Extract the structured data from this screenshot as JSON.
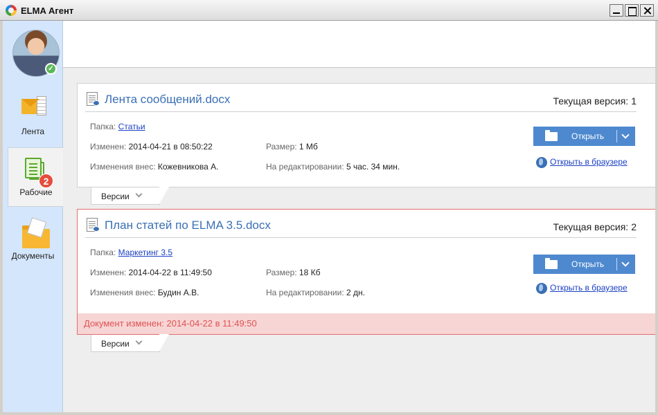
{
  "window": {
    "title": "ELMA Агент"
  },
  "sidebar": {
    "items": [
      {
        "label": "Лента"
      },
      {
        "label": "Рабочие",
        "badge": "2"
      },
      {
        "label": "Документы"
      }
    ],
    "avatar_status": "✓"
  },
  "documents": [
    {
      "title": "Лента сообщений.docx",
      "version_label": "Текущая версия:",
      "version": "1",
      "folder_key": "Папка:",
      "folder": "Статьи",
      "modified_key": "Изменен:",
      "modified": "2014-04-21 в 08:50:22",
      "size_key": "Размер:",
      "size": "1 Мб",
      "author_key": "Изменения внес:",
      "author": "Кожевникова А.",
      "editing_key": "На редактировании:",
      "editing": "5 час. 34 мин.",
      "open_label": "Открыть",
      "browser_label": "Открыть в браузере",
      "versions_label": "Версии"
    },
    {
      "title": "План статей по ELMA 3.5.docx",
      "version_label": "Текущая версия:",
      "version": "2",
      "folder_key": "Папка:",
      "folder": "Маркетинг 3.5",
      "modified_key": "Изменен:",
      "modified": "2014-04-22 в 11:49:50",
      "size_key": "Размер:",
      "size": "18 Кб",
      "author_key": "Изменения внес:",
      "author": "Будин А.В.",
      "editing_key": "На редактировании:",
      "editing": "2 дн.",
      "open_label": "Открыть",
      "browser_label": "Открыть в браузере",
      "versions_label": "Версии",
      "changed_notice": "Документ изменен: 2014-04-22 в 11:49:50"
    }
  ],
  "colors": {
    "accent": "#4e89cf",
    "link": "#1a3fc4",
    "title": "#3a6fb5",
    "sidebar_bg": "#d4e6fb",
    "changed_bg": "#f7d5d5",
    "changed_text": "#e05252",
    "badge": "#e74c3c"
  }
}
